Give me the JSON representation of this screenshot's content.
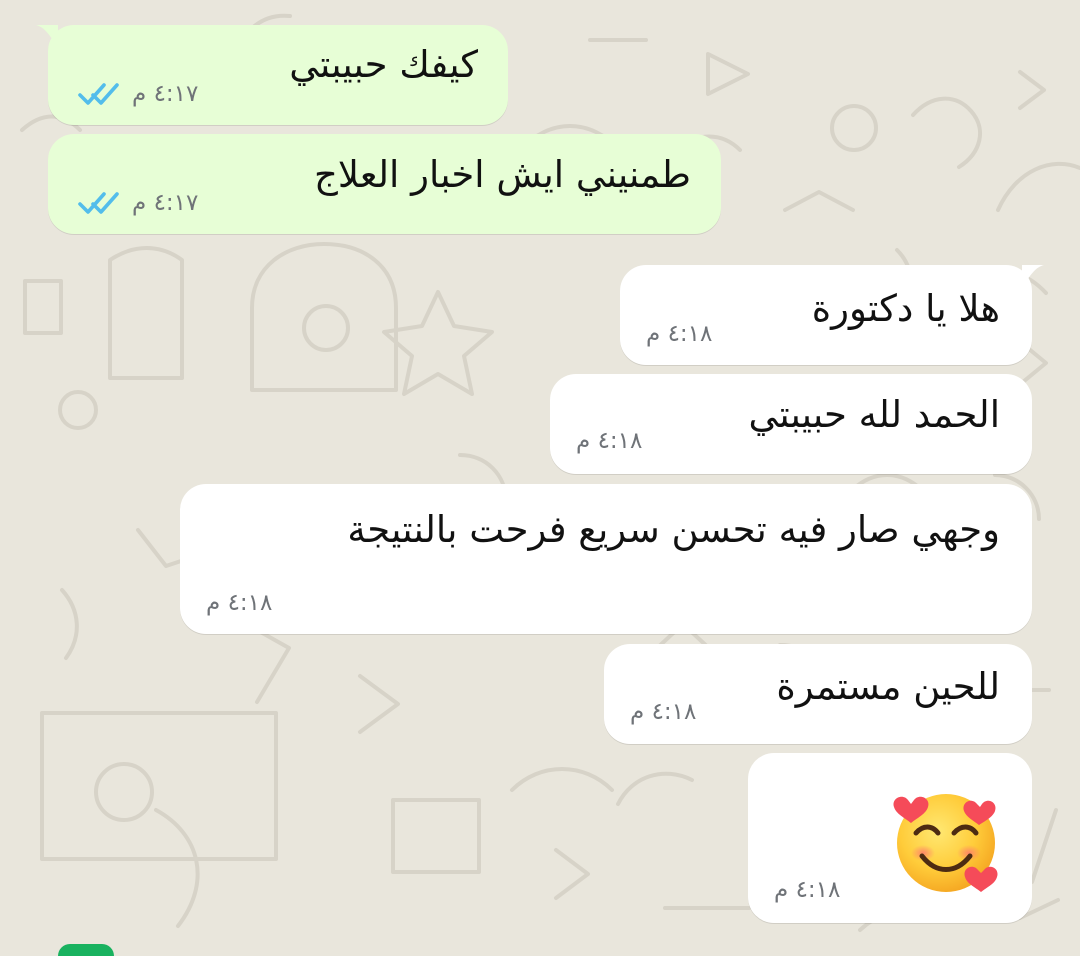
{
  "messages": [
    {
      "direction": "out",
      "text": "كيفك حبيبتي",
      "time": "٤:١٧ م",
      "status": "read",
      "status_icon": "double-check-icon"
    },
    {
      "direction": "out",
      "text": "طمنيني ايش اخبار العلاج",
      "time": "٤:١٧ م",
      "status": "read",
      "status_icon": "double-check-icon"
    },
    {
      "direction": "in",
      "text": "هلا يا دكتورة",
      "time": "٤:١٨ م"
    },
    {
      "direction": "in",
      "text": "الحمد لله حبيبتي",
      "time": "٤:١٨ م"
    },
    {
      "direction": "in",
      "text": "وجهي صار فيه تحسن سريع فرحت بالنتيجة",
      "time": "٤:١٨ م"
    },
    {
      "direction": "in",
      "text": "للحين مستمرة",
      "time": "٤:١٨ م"
    },
    {
      "direction": "in",
      "emoji": "🥰",
      "emoji_name": "smiling-face-with-hearts-icon",
      "time": "٤:١٨ م"
    }
  ],
  "colors": {
    "background": "#e9e6dc",
    "outgoing_bubble": "#e7fed6",
    "incoming_bubble": "#ffffff",
    "read_ticks": "#53bdeb",
    "meta_text": "#6f7378",
    "message_text": "#111111"
  }
}
